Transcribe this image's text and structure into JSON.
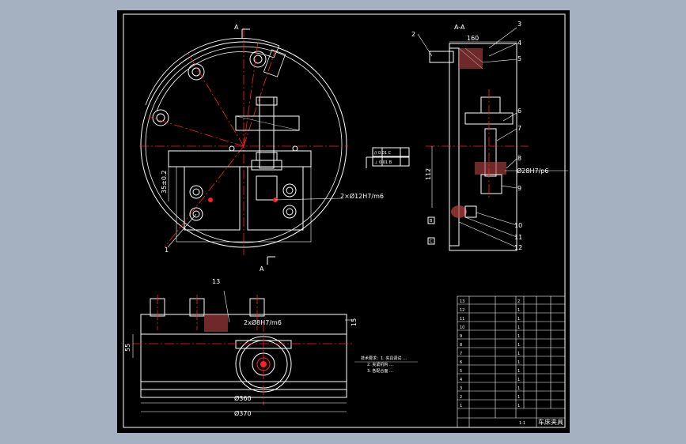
{
  "drawing": {
    "section_title": "A-A",
    "section_marker": "A",
    "top_dim": "160",
    "callouts": [
      "1",
      "2",
      "3",
      "4",
      "5",
      "6",
      "7",
      "8",
      "9",
      "10",
      "11",
      "12",
      "13"
    ],
    "dim_left": "35±0.2",
    "dim_height": "112",
    "dim_hole": "2×Ø12H7/m6",
    "dim_side_bore": "Ø28H7/p6",
    "dim_bottom_holes": "2xØ8H7/m6",
    "dim_base_width": "Ø360",
    "dim_base_width2": "Ø370",
    "dim_left_height": "55",
    "dim_right_small": "15",
    "tolerance_frame_1": "// 0.01 C",
    "tolerance_frame_2": "⊥ 0.01 B",
    "datum_b": "B",
    "datum_c": "C",
    "notes": [
      "技术要求：1. 夹具调试 …",
      "2. 夹紧机构 …",
      "3. 各配合面 …"
    ]
  },
  "title_block": {
    "rows": [
      {
        "no": "13",
        "code": "",
        "name": "",
        "qty": "2"
      },
      {
        "no": "12",
        "code": "",
        "name": "",
        "qty": "1"
      },
      {
        "no": "11",
        "code": "",
        "name": "",
        "qty": "1"
      },
      {
        "no": "10",
        "code": "",
        "name": "",
        "qty": "1"
      },
      {
        "no": "9",
        "code": "",
        "name": "",
        "qty": "1"
      },
      {
        "no": "8",
        "code": "",
        "name": "",
        "qty": "1"
      },
      {
        "no": "7",
        "code": "",
        "name": "",
        "qty": "1"
      },
      {
        "no": "6",
        "code": "",
        "name": "",
        "qty": "1"
      },
      {
        "no": "5",
        "code": "",
        "name": "",
        "qty": "1"
      },
      {
        "no": "4",
        "code": "",
        "name": "",
        "qty": "1"
      },
      {
        "no": "3",
        "code": "",
        "name": "",
        "qty": "1"
      },
      {
        "no": "2",
        "code": "",
        "name": "",
        "qty": "1"
      },
      {
        "no": "1",
        "code": "",
        "name": "",
        "qty": "1"
      }
    ],
    "title": "车床夹具",
    "scale": "1:1"
  },
  "colors": {
    "bg": "#000000",
    "frame": "#a5b1c0",
    "line": "#ffffff",
    "red": "#ff2020",
    "center": "#ff3030"
  }
}
